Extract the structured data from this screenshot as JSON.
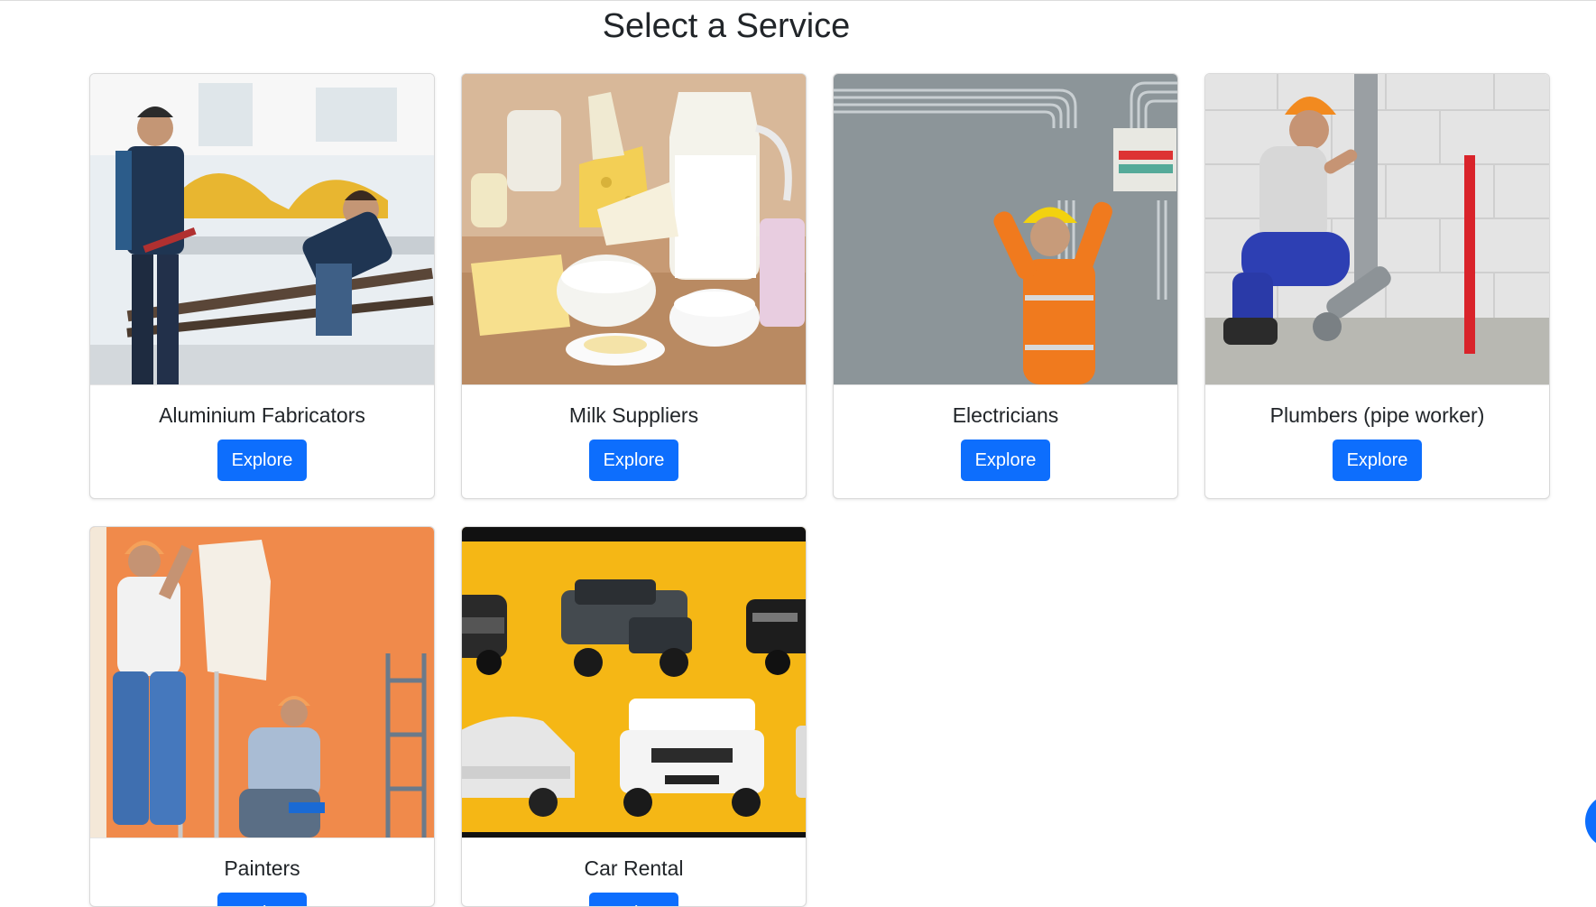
{
  "page": {
    "title": "Select a Service"
  },
  "services": [
    {
      "name": "Aluminium Fabricators",
      "button": "Explore"
    },
    {
      "name": "Milk Suppliers",
      "button": "Explore"
    },
    {
      "name": "Electricians",
      "button": "Explore"
    },
    {
      "name": "Plumbers (pipe worker)",
      "button": "Explore"
    },
    {
      "name": "Painters",
      "button": "Explore"
    },
    {
      "name": "Car Rental",
      "button": "Explore"
    }
  ],
  "colors": {
    "primary": "#0d6efd",
    "text": "#212529",
    "painter_wall": "#f08a4b",
    "car_bg": "#f5b715"
  }
}
